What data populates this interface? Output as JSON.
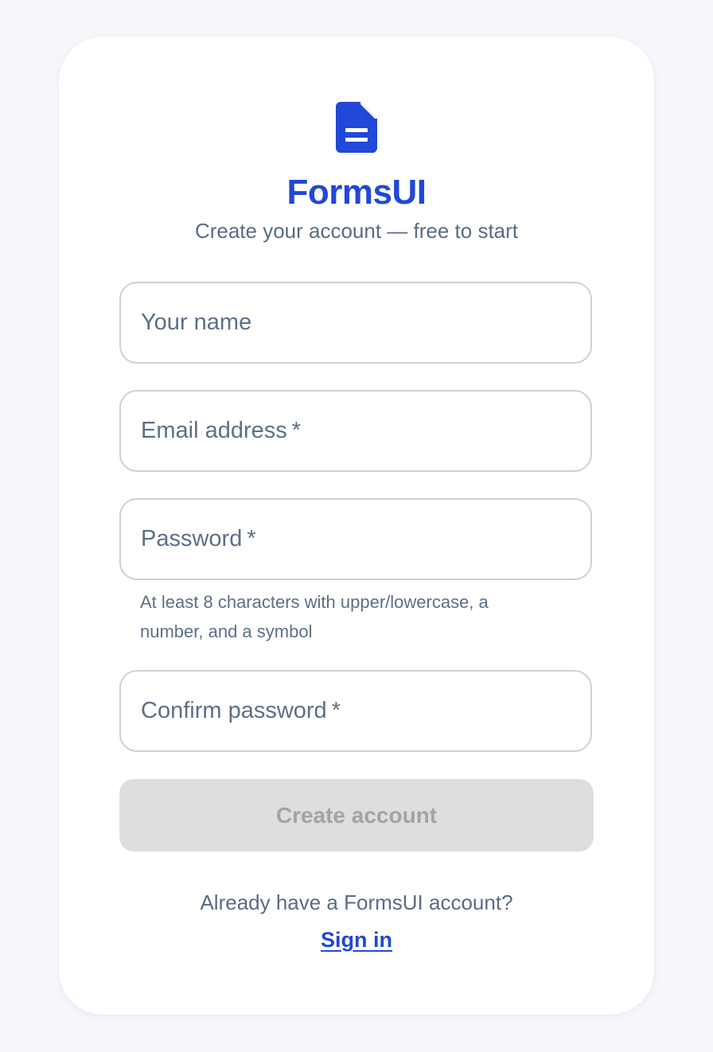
{
  "brand": {
    "name": "FormsUI",
    "subtitle": "Create your account — free to start",
    "logo_icon": "document-icon",
    "accent_color": "#2148d6"
  },
  "form": {
    "fields": [
      {
        "label": "Your name",
        "required": false,
        "value": ""
      },
      {
        "label": "Email address",
        "required": true,
        "value": ""
      },
      {
        "label": "Password",
        "required": true,
        "value": ""
      },
      {
        "label": "Confirm password",
        "required": true,
        "value": ""
      }
    ],
    "required_marker": "*",
    "password_hint": "At least 8 characters with upper/lowercase, a number, and a symbol",
    "submit_label": "Create account",
    "submit_disabled": true
  },
  "footer": {
    "prompt": "Already have a FormsUI account?",
    "signin_label": "Sign in"
  }
}
